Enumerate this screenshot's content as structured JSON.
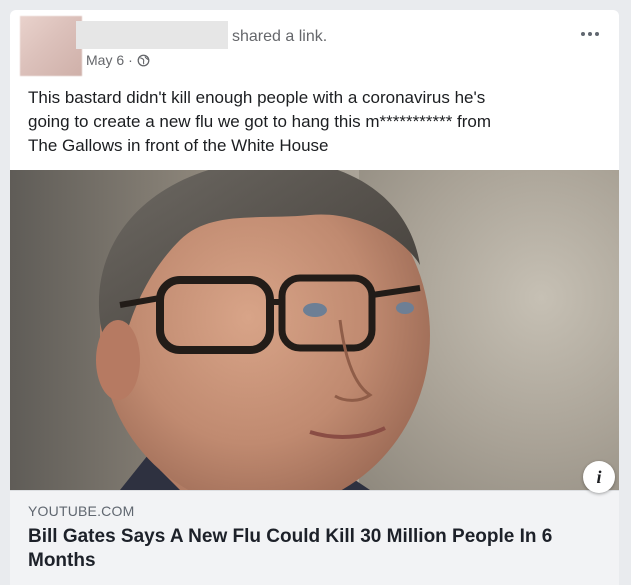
{
  "post": {
    "shared_text": "shared a link.",
    "date": "May 6",
    "separator": "·",
    "more_label": "•••",
    "body": "This bastard didn't kill enough people with a coronavirus he's\ngoing to create a new flu we got to hang this m*********** from\nThe Gallows in front of the White House"
  },
  "link": {
    "domain": "YOUTUBE.COM",
    "title": "Bill Gates Says A New Flu Could Kill 30 Million People In 6 Months",
    "info_icon": "i"
  },
  "icons": {
    "privacy": "globe-icon",
    "info": "info-icon",
    "more": "more-icon"
  },
  "colors": {
    "page_bg": "#e9ebee",
    "card_bg": "#ffffff",
    "meta_text": "#65676b",
    "link_box_bg": "#f2f3f5"
  }
}
